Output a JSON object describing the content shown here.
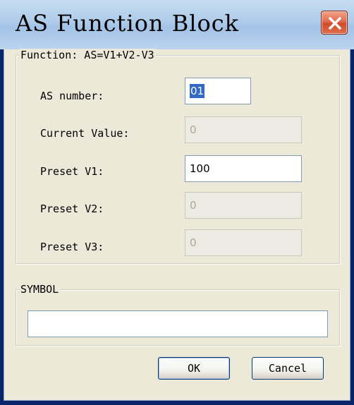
{
  "window": {
    "title": "AS Function Block"
  },
  "function_group": {
    "legend": "Function:  AS=V1+V2-V3",
    "fields": [
      {
        "label": "AS number:",
        "value": "01",
        "enabled": true
      },
      {
        "label": "Current Value:",
        "value": "0",
        "enabled": false
      },
      {
        "label": "Preset V1:",
        "value": "100",
        "enabled": true
      },
      {
        "label": "Preset V2:",
        "value": "0",
        "enabled": false
      },
      {
        "label": "Preset V3:",
        "value": "0",
        "enabled": false
      }
    ]
  },
  "symbol_group": {
    "legend": "SYMBOL",
    "value": ""
  },
  "buttons": {
    "ok": "OK",
    "cancel": "Cancel"
  },
  "colors": {
    "title_bar": "#aecbea",
    "close_button": "#d04a2a",
    "dialog_face": "#ece9d8",
    "selection": "#316ac5"
  },
  "icons": {
    "close": "close-icon"
  }
}
